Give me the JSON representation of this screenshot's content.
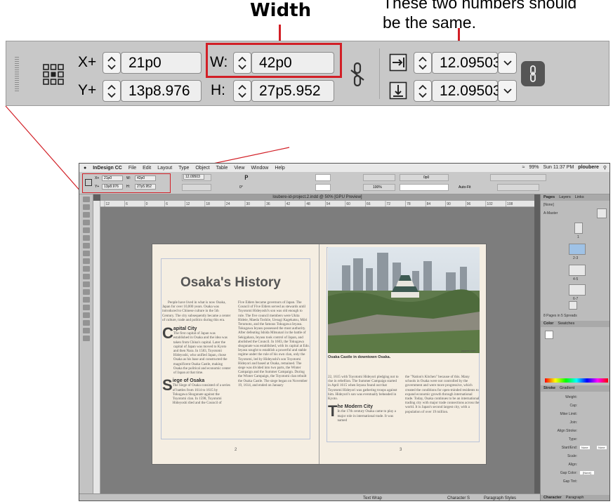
{
  "callouts": {
    "width": "Width",
    "same_line1": "These two numbers should",
    "same_line2": "be the same."
  },
  "control_bar": {
    "x_label": "X+",
    "x_value": "21p0",
    "y_label": "Y+",
    "y_value": "13p8.976",
    "w_label": "W:",
    "w_value": "42p0",
    "h_label": "H:",
    "h_value": "27p5.952",
    "scale_x_value": "12.09503",
    "scale_y_value": "12.09503"
  },
  "app": {
    "menu": {
      "apple": "",
      "app_name": "InDesign CC",
      "items": [
        "File",
        "Edit",
        "Layout",
        "Type",
        "Object",
        "Table",
        "View",
        "Window",
        "Help"
      ],
      "zoom": "99%",
      "clock": "Sun 11:37 PM",
      "user": "ploubere"
    },
    "mini_bar": {
      "x_label": "X+",
      "x_value": "21p0",
      "y_label": "Y+",
      "y_value": "13p8.976",
      "w_label": "W:",
      "w_value": "42p0",
      "h_label": "H:",
      "h_value": "27p5.952",
      "scale_value": "12.09503",
      "angle_value": "0°",
      "stroke_value": "0p0",
      "percent_value": "100%",
      "autofit_label": "Auto-Fit"
    },
    "doc_tab": "loubere-id-project.2.indd @ 50% [GPU Preview]",
    "ruler_ticks": [
      "12",
      "6",
      "0",
      "6",
      "12",
      "18",
      "24",
      "30",
      "36",
      "42",
      "48",
      "54",
      "60",
      "66",
      "72",
      "78",
      "84",
      "90",
      "96",
      "102",
      "108"
    ],
    "document": {
      "title": "Osaka's History",
      "intro": "People have lived in what is now Osaka, Japan for over 10,000 years. Osaka was introduced to Chinese culture in the 5th Century. The city subsequently became a center of culture, trade and politics during this era.",
      "sub1": "apital City",
      "sub1_cap": "C",
      "sub1_text": "The first capital of Japan was established in Osaka and the idea was taken from China's capital. Later the capital of Japan was moved to Kyoto and then Nara. In 1583, Toyotomi Hideyoshi, who unified Japan, chose Osaka as his base and constructed the magnificent Osaka Castle, making Osaka the political and economic center of Japan at that time.",
      "sub2": "iege of Osaka",
      "sub2_cap": "S",
      "sub2_text": "The Siege of Osaka consisted of a series of battles from 1614 to 1615 by Tokugawa Shogunate against the Toyotomi clan. In 1598, Toyotomi Hideyoshi died and the Council of",
      "col2": "Five Elders became governors of Japan. The Council of Five Elders served as stewards until Toyotomi Hideyoshi's son was old enough to rule. The five council members were Ukita Hideie, Maeda Toshiie, Uesugi Kagekatsu, Mōri Terumoto, and the famous Tokugawa Ieyasu. Tokugawa Ieyasu possessed the most authority. After defeating Ishida Mitsunari in the battle of Sekigahara, Ieyasu took control of Japan, and abolished the Council. In 1603, the Tokugawa shogunate was established, with its capital at Edo. Ieyasu sought to establish a powerful and stable regime under the rule of his own clan, only the Toyotomi, led by Hideyoshi's son Toyotomi Hideyori and based at Osaka, remained. The siege was divided into two parts, the Winter Campaign and the Summer Campaign. During the Winter Campaign, the Toyotomi clan rebuilt the Osaka Castle. The siege began on November 19, 1614, and ended on January",
      "caption": "Osaka Castle in downtown Osaka.",
      "photo_credit": "jaypee.com",
      "col3": "22, 1615 with Toyotomi Hideyori pledging not to rise in rebellion. The Summer Campaign started in April 1615 when Ieyasu found out that Toyotomi Hideyori was gathering troops against him. Hideyori's son was eventually beheaded in Kyoto.",
      "sub3": "he Modern City",
      "sub3_cap": "T",
      "sub3_text": "In the 17th century Osaka came to play a major role in international trade. It was named",
      "col4": "the \"Nation's Kitchen\" because of this. Many schools in Osaka were not controlled by the government and were more progressive, which created the conditions for open-minded residents to expand economic growth through international trade. Today, Osaka continues to be an international trading city with major trade connections across the world. It is Japan's second largest city, with a population of over 19 million.",
      "page_left": "2",
      "page_right": "3"
    },
    "panels": {
      "pages_tabs": [
        "Pages",
        "Layers",
        "Links"
      ],
      "none_label": "[None]",
      "master_label": "A-Master",
      "page_labels": [
        "1",
        "2-3",
        "4-5",
        "6-7"
      ],
      "pages_summary": "8 Pages in 5 Spreads",
      "color_tabs": [
        "Color",
        "Swatches"
      ],
      "stroke_tabs": [
        "Stroke",
        "Gradient"
      ],
      "stroke_rows": [
        "Weight:",
        "Cap:",
        "Miter Limit:",
        "Join:",
        "Align Stroke:",
        "Type:",
        "Start/End:",
        "Scale:",
        "Align:",
        "Gap Color:",
        "Gap Tint:"
      ],
      "start_none": "None",
      "end_none": "None",
      "gap_color_value": "[None]",
      "bottom_tabs": [
        "Character",
        "Paragraph"
      ]
    },
    "status": {
      "text_wrap": "Text Wrap",
      "character_styles": "Character S",
      "paragraph_styles": "Paragraph Styles"
    }
  },
  "colors": {
    "highlight": "#d21f26",
    "bar_bg": "#c8c8c8",
    "pasteboard": "#7d7d7d",
    "paper": "#f5eee2"
  }
}
